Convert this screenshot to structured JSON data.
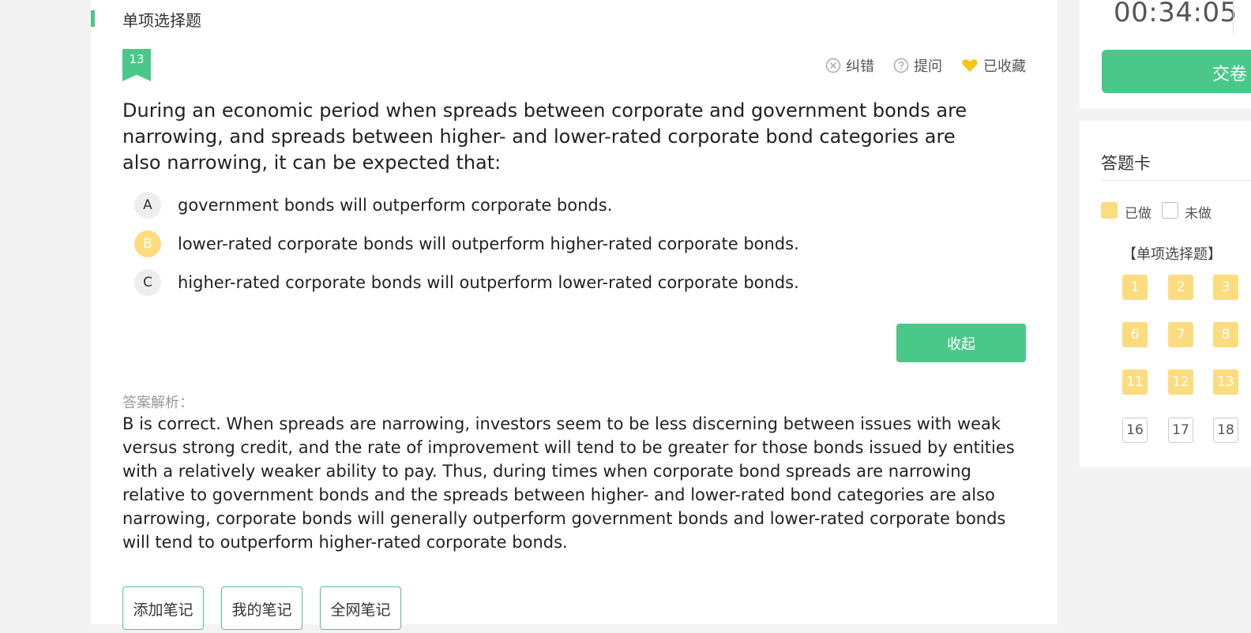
{
  "section": {
    "title": "单项选择题"
  },
  "question": {
    "number": "13",
    "tools": [
      {
        "icon": "report-error-icon",
        "label": "纠错"
      },
      {
        "icon": "question-icon",
        "label": "提问"
      },
      {
        "icon": "heart-icon",
        "label": "已收藏"
      }
    ],
    "text": "During an economic period when spreads between corporate and government bonds are narrowing, and spreads between higher- and lower-rated corporate bond categories are also narrowing, it can be expected that:",
    "options": [
      {
        "letter": "A",
        "text": "government bonds will outperform corporate bonds.",
        "selected": false
      },
      {
        "letter": "B",
        "text": "lower-rated corporate bonds will outperform higher-rated corporate bonds.",
        "selected": true
      },
      {
        "letter": "C",
        "text": "higher-rated corporate bonds will outperform lower-rated corporate bonds.",
        "selected": false
      }
    ],
    "collapse_label": "收起"
  },
  "analysis": {
    "label": "答案解析：",
    "text": "B is correct. When spreads are narrowing, investors seem to be less discerning between issues with weak versus strong credit, and the rate of improvement will tend to be greater for those bonds issued by entities with a relatively weaker ability to pay. Thus, during times when corporate bond spreads are narrowing relative to government bonds and the spreads between higher- and lower-rated  bond categories are also narrowing, corporate bonds will generally outperform government bonds and lower-rated corporate bonds will tend to outperform higher-rated corporate bonds."
  },
  "notes": {
    "add": "添加笔记",
    "mine": "我的笔记",
    "all": "全网笔记"
  },
  "sidebar": {
    "timer": "00:34:05",
    "submit_label": "交卷",
    "card_title": "答题卡",
    "legend_done": "已做",
    "legend_todo": "未做",
    "card_section": "【单项选择题】",
    "cells": [
      {
        "num": "1",
        "status": "done"
      },
      {
        "num": "2",
        "status": "done"
      },
      {
        "num": "3",
        "status": "done"
      },
      {
        "num": "6",
        "status": "done"
      },
      {
        "num": "7",
        "status": "done"
      },
      {
        "num": "8",
        "status": "done"
      },
      {
        "num": "11",
        "status": "done"
      },
      {
        "num": "12",
        "status": "done"
      },
      {
        "num": "13",
        "status": "done"
      },
      {
        "num": "16",
        "status": "todo"
      },
      {
        "num": "17",
        "status": "todo"
      },
      {
        "num": "18",
        "status": "todo"
      }
    ]
  },
  "colors": {
    "accent": "#4ac88a",
    "done": "#fddc7f",
    "heart": "#f5c518"
  }
}
